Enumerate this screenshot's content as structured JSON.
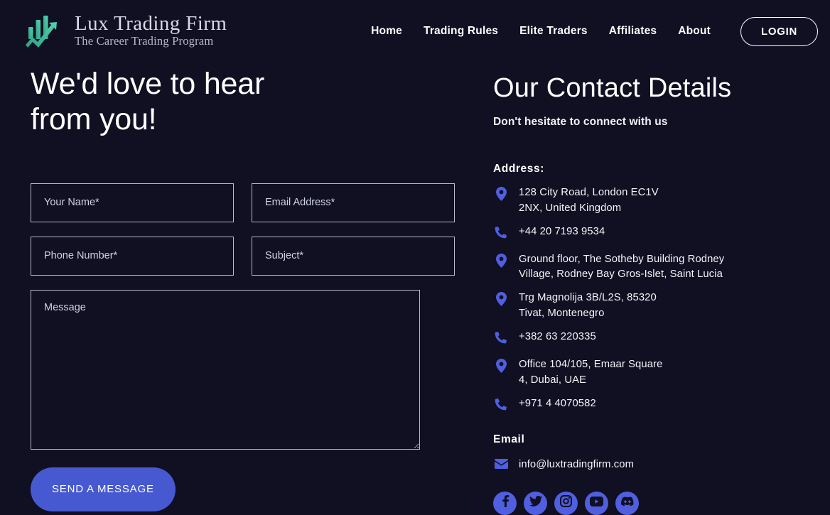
{
  "theme": {
    "background": "#110f22",
    "accent_blue": "#4659d0",
    "icon_blue": "#4f5fe0",
    "logo_teal": "#3fbf9c",
    "field_border": "#b9bacb"
  },
  "header": {
    "logo_icon": "bar-chart-arrow-logo",
    "brand_title": "Lux Trading Firm",
    "brand_subtitle": "The Career Trading Program",
    "nav": [
      {
        "label": "Home",
        "name": "nav-link-home"
      },
      {
        "label": "Trading Rules",
        "name": "nav-link-trading-rules"
      },
      {
        "label": "Elite Traders",
        "name": "nav-link-elite-traders"
      },
      {
        "label": "Affiliates",
        "name": "nav-link-affiliates"
      },
      {
        "label": "About",
        "name": "nav-link-about"
      }
    ],
    "login_label": "LOGIN"
  },
  "left": {
    "hero_title": "We'd love to hear\nfrom you!",
    "form": {
      "name_placeholder": "Your Name*",
      "email_placeholder": "Email Address*",
      "phone_placeholder": "Phone Number*",
      "subject_placeholder": "Subject*",
      "message_placeholder": "Message",
      "name_value": "",
      "email_value": "",
      "phone_value": "",
      "subject_value": "",
      "message_value": "",
      "submit_label": "SEND A MESSAGE"
    }
  },
  "right": {
    "title": "Our Contact Details",
    "subtitle": "Don't hesitate to connect with us",
    "address_label": "Address:",
    "contacts": [
      {
        "icon": "location-pin-icon",
        "type": "address",
        "text": "128 City Road, London EC1V\n2NX, United Kingdom"
      },
      {
        "icon": "phone-icon",
        "type": "phone",
        "text": "+44 20 7193 9534"
      },
      {
        "icon": "location-pin-icon",
        "type": "address",
        "text": "Ground floor, The Sotheby Building Rodney\nVillage, Rodney Bay Gros-Islet, Saint Lucia"
      },
      {
        "icon": "location-pin-icon",
        "type": "address",
        "text": "Trg Magnolija 3B/L2S, 85320\nTivat, Montenegro"
      },
      {
        "icon": "phone-icon",
        "type": "phone",
        "text": "+382 63 220335"
      },
      {
        "icon": "location-pin-icon",
        "type": "address",
        "text": "Office 104/105, Emaar Square\n4, Dubai, UAE"
      },
      {
        "icon": "phone-icon",
        "type": "phone",
        "text": "+971 4 4070582"
      }
    ],
    "email_label": "Email",
    "emails": [
      {
        "icon": "envelope-icon",
        "text": "info@luxtradingfirm.com"
      }
    ],
    "socials": [
      {
        "name": "facebook-icon",
        "label": "Facebook"
      },
      {
        "name": "twitter-icon",
        "label": "Twitter"
      },
      {
        "name": "instagram-icon",
        "label": "Instagram"
      },
      {
        "name": "youtube-icon",
        "label": "YouTube"
      },
      {
        "name": "discord-icon",
        "label": "Discord"
      }
    ]
  }
}
